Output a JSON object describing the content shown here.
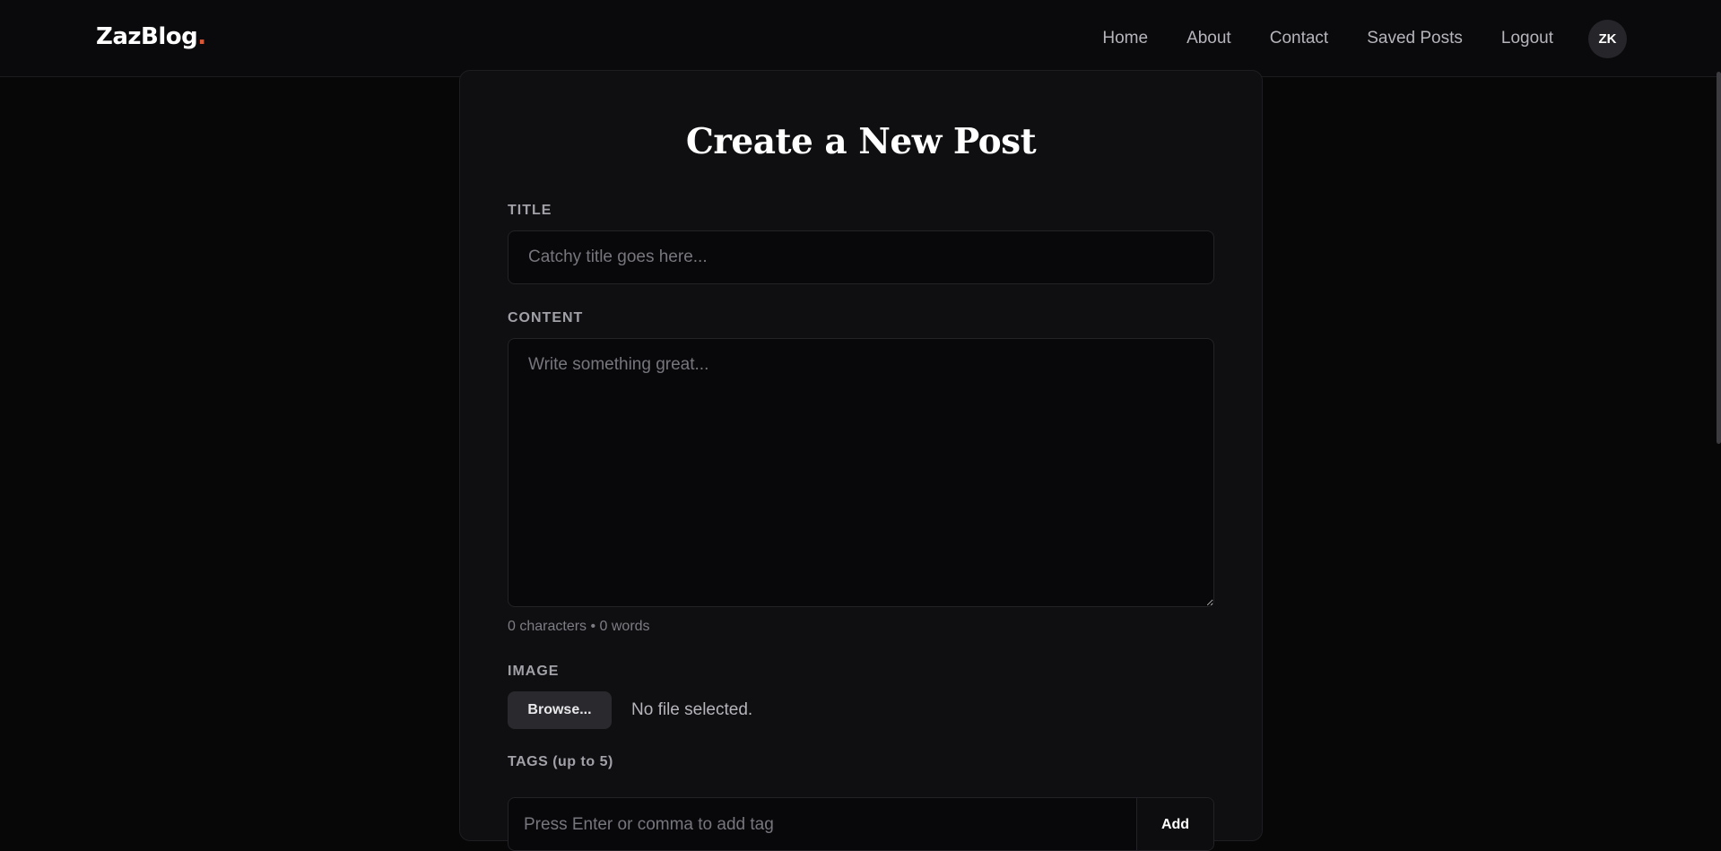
{
  "brand": {
    "name": "ZazBlog",
    "dot": "."
  },
  "nav": {
    "links": [
      "Home",
      "About",
      "Contact",
      "Saved Posts",
      "Logout"
    ],
    "avatar_initials": "ZK"
  },
  "form": {
    "heading": "Create a New Post",
    "title_label": "TITLE",
    "title_placeholder": "Catchy title goes here...",
    "title_value": "",
    "content_label": "CONTENT",
    "content_placeholder": "Write something great...",
    "content_value": "",
    "counter": "0 characters • 0 words",
    "image_label": "IMAGE",
    "browse_label": "Browse...",
    "file_status": "No file selected.",
    "tags_label": "TAGS (up to 5)",
    "tags_placeholder": "Press Enter or comma to add tag",
    "add_label": "Add"
  },
  "colors": {
    "background": "#070708",
    "card": "#0f0f11",
    "accent_dot": "#e5532e"
  }
}
